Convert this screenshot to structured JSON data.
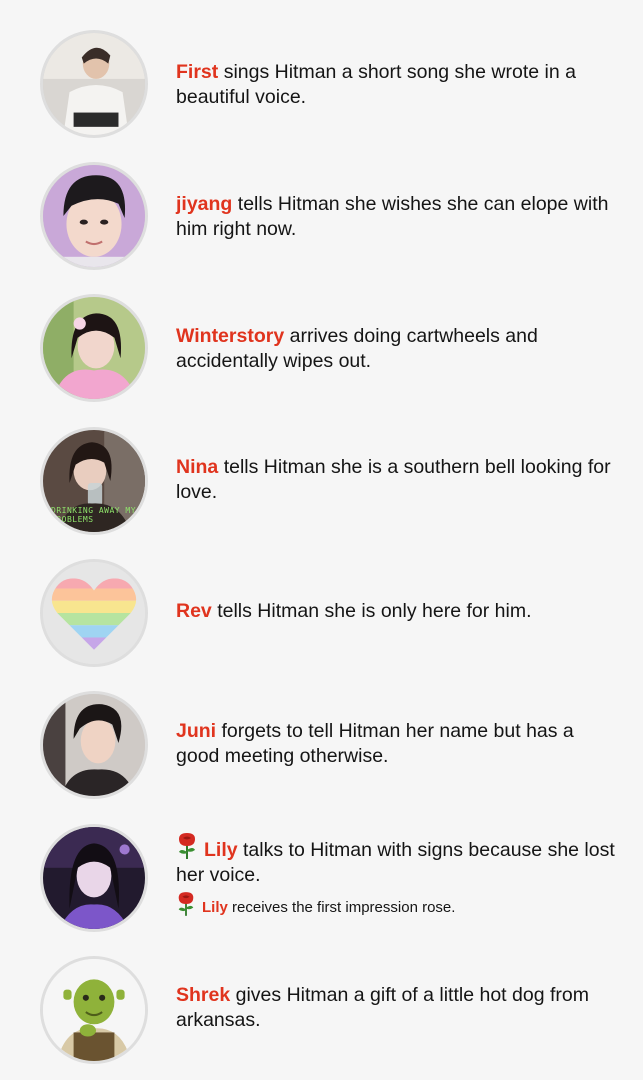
{
  "entries": [
    {
      "name": "First",
      "text": "sings Hitman a short song she wrote in a beautiful voice.",
      "avatar_icon": "avatar-photo-person-white-shirt"
    },
    {
      "name": "jiyang",
      "text": "tells Hitman she wishes she can elope with him right now.",
      "avatar_icon": "avatar-photo-person-smiling"
    },
    {
      "name": "Winterstory",
      "text": "arrives doing cartwheels and accidentally wipes out.",
      "avatar_icon": "avatar-photo-person-pink-dress"
    },
    {
      "name": "Nina",
      "text": "tells Hitman she is a southern bell looking for love.",
      "avatar_icon": "avatar-photo-person-drinking",
      "avatar_caption": "DRINKING AWAY MY PROBLEMS"
    },
    {
      "name": "Rev",
      "text": "tells Hitman she is only here for him.",
      "avatar_icon": "rainbow-heart-icon"
    },
    {
      "name": "Juni",
      "text": "forgets to tell Hitman her name but has a good meeting otherwise.",
      "avatar_icon": "avatar-photo-person-dark-hair"
    },
    {
      "name": "Lily",
      "text": "talks to Hitman with signs because she lost her voice.",
      "avatar_icon": "avatar-photo-person-purple-light",
      "rose_icon": "rose-icon",
      "sub_name": "Lily",
      "sub_text": "receives the first impression rose."
    },
    {
      "name": "Shrek",
      "text": "gives Hitman a gift of a little hot dog from arkansas.",
      "avatar_icon": "avatar-shrek-icon"
    }
  ],
  "colors": {
    "name_accent": "#e0341e",
    "background": "#f6f6f6",
    "avatar_border": "#dedede"
  }
}
